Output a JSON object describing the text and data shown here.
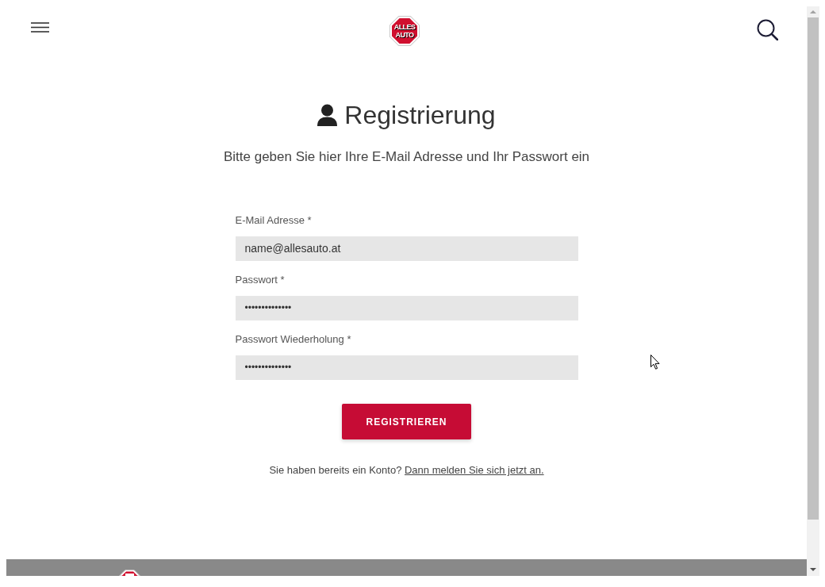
{
  "header": {
    "logo": {
      "lines": [
        "ALLES",
        "AUTO"
      ]
    }
  },
  "title": "Registrierung",
  "subtitle": "Bitte geben Sie hier Ihre E-Mail Adresse und Ihr Passwort ein",
  "fields": [
    {
      "kind": "email",
      "label": "E-Mail Adresse *",
      "value": "name@allesauto.at"
    },
    {
      "kind": "password",
      "label": "Passwort *",
      "value": "••••••••••••••"
    },
    {
      "kind": "password",
      "label": "Passwort Wiederholung *",
      "value": "••••••••••••••"
    }
  ],
  "submit_button": "REGISTRIEREN",
  "login_prompt": {
    "text": "Sie haben bereits ein Konto?",
    "link": "Dann melden Sie sich jetzt an."
  }
}
